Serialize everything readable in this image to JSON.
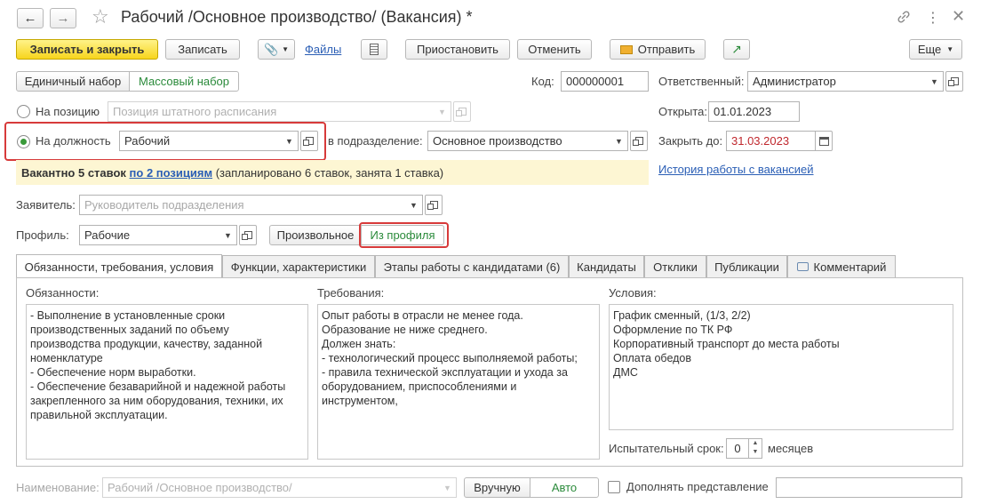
{
  "window": {
    "title": "Рабочий /Основное производство/ (Вакансия) *"
  },
  "toolbar": {
    "save_close": "Записать и закрыть",
    "save": "Записать",
    "files": "Файлы",
    "suspend": "Приостановить",
    "cancel": "Отменить",
    "send": "Отправить",
    "more": "Еще"
  },
  "mode": {
    "single": "Единичный набор",
    "mass": "Массовый набор"
  },
  "code": {
    "label": "Код:",
    "value": "000000001"
  },
  "responsible": {
    "label": "Ответственный:",
    "value": "Администратор"
  },
  "position_option": {
    "label": "На позицию",
    "placeholder": "Позиция штатного расписания"
  },
  "opened": {
    "label": "Открыта:",
    "value": "01.01.2023"
  },
  "post_option": {
    "label": "На должность",
    "value": "Рабочий"
  },
  "division": {
    "label": "в подразделение:",
    "value": "Основное производство"
  },
  "close_until": {
    "label": "Закрыть до:",
    "value": "31.03.2023"
  },
  "vacancy_info": {
    "prefix": "Вакантно 5 ставок",
    "link": "по 2 позициям",
    "suffix": "(запланировано 6 ставок, занята 1 ставка)"
  },
  "history_link": "История работы с вакансией",
  "applicant": {
    "label": "Заявитель:",
    "placeholder": "Руководитель подразделения"
  },
  "profile": {
    "label": "Профиль:",
    "value": "Рабочие",
    "arbitrary": "Произвольное",
    "from_profile": "Из профиля"
  },
  "tabs": [
    {
      "label": "Обязанности, требования, условия"
    },
    {
      "label": "Функции, характеристики"
    },
    {
      "label": "Этапы работы с кандидатами (6)"
    },
    {
      "label": "Кандидаты"
    },
    {
      "label": "Отклики"
    },
    {
      "label": "Публикации"
    },
    {
      "label": "Комментарий"
    }
  ],
  "duties": {
    "label": "Обязанности:",
    "text": "- Выполнение в установленные сроки\nпроизводственных заданий по объему\nпроизводства продукции, качеству, заданной\nноменклатуре\n- Обеспечение норм выработки.\n- Обеспечение безаварийной и надежной работы\nзакрепленного за ним оборудования, техники, их\nправильной эксплуатации."
  },
  "requirements": {
    "label": "Требования:",
    "text": "Опыт работы в отрасли не менее года.\nОбразование не ниже среднего.\nДолжен знать:\n- технологический процесс выполняемой работы;\n- правила технической эксплуатации и ухода за\nоборудованием, приспособлениями и\nинструментом,"
  },
  "conditions": {
    "label": "Условия:",
    "text": "График сменный, (1/3, 2/2)\nОформление по ТК РФ\nКорпоративный транспорт до места работы\nОплата обедов\nДМС"
  },
  "probation": {
    "label": "Испытательный срок:",
    "value": "0",
    "unit": "месяцев"
  },
  "name_row": {
    "label": "Наименование:",
    "value": "Рабочий /Основное производство/",
    "manual": "Вручную",
    "auto": "Авто",
    "extend": "Дополнять представление"
  }
}
